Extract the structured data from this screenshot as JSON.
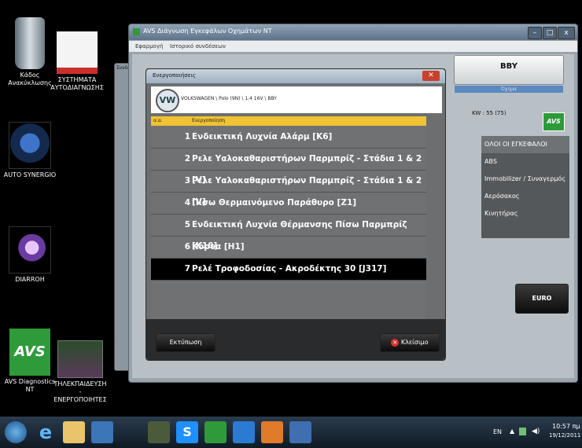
{
  "desktop": {
    "icons": [
      {
        "label": "Κάδος Ανακύκλωσης"
      },
      {
        "label": "ΣΥΣΤΗΜΑΤΑ ΑΥΤΟΔΙΑΓΝΩΣΗΣ"
      },
      {
        "label": "AUTO SYNERGIO"
      },
      {
        "label": "DIARROH"
      },
      {
        "label": "AVS Diagnostics NT"
      },
      {
        "label": "ΤΗΛΕΚΠΑΙΔΕΥΣΗ - ΕΝΕΡΓΟΠΟΙΗΤΕΣ"
      }
    ]
  },
  "main_window": {
    "title": "AVS Διάγνωση Εγκεφάλων Οχημάτων NT",
    "menu": [
      "Εφαρμογή",
      "Ιστορικό συνδέσεων"
    ],
    "vehicle_code": "BBY",
    "vehicle_sub": "Όχημα",
    "kw_label": "KW : 55 (75)",
    "ecu_list": [
      "ΟΛΟΙ ΟΙ ΕΓΚΕΦΑΛΟΙ",
      "ABS",
      "Immobilizer / Συναγερμός",
      "Αερόσακος",
      "Κινητήρας"
    ],
    "euro_button": "EURO",
    "back_tab": "Συνδεσ",
    "avs_tag": "AVS"
  },
  "dialog": {
    "title": "Ενεργοποιήσεις",
    "vehicle": "VOLKSWAGEN \\ Polo (9N) \\ 1.4 16V \\ BBY",
    "columns": [
      "α.α.",
      "Ενεργοποίηση"
    ],
    "rows": [
      {
        "num": "1",
        "label": "Ενδεικτική Λυχνία Αλάρμ [K6]"
      },
      {
        "num": "2",
        "label": "Ρελε Υαλοκαθαριστήρων Παρμπρίζ - Στάδια 1 & 2 [V]"
      },
      {
        "num": "3",
        "label": "Ρελε Υαλοκαθαριστήρων Παρμπρίζ - Στάδια 1 & 2 [V]"
      },
      {
        "num": "4",
        "label": "Πίσω Θερμαινόμενο Παράθυρο [Z1]"
      },
      {
        "num": "5",
        "label": "Ενδεικτική Λυχνία Θέρμανσης Πίσω Παρμπρίζ [K10]"
      },
      {
        "num": "6",
        "label": "Κόρνα [H1]"
      },
      {
        "num": "7",
        "label": "Ρελέ Τροφοδοσίας - Ακροδέκτης 30 [J317]"
      }
    ],
    "print_button": "Εκτύπωση",
    "close_button": "Κλείσιμο"
  },
  "taskbar": {
    "language": "EN",
    "time": "10:57 πμ",
    "date": "19/12/2011"
  },
  "colors": {
    "header_yellow": "#f1c232",
    "row_gray": "#6f7173",
    "selected_row": "#000000",
    "avs_green": "#2f9a3a"
  }
}
